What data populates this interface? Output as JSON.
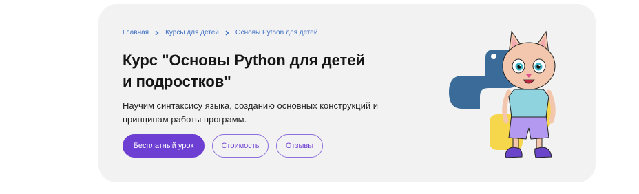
{
  "breadcrumb": {
    "items": [
      "Главная",
      "Курсы для детей",
      "Основы Python для детей"
    ]
  },
  "hero": {
    "title": "Курс \"Основы Python для детей и подростков\"",
    "subtitle": "Научим синтаксису языка, созданию основных конструкций и принципам работы программ."
  },
  "actions": {
    "free_lesson": "Бесплатный урок",
    "price": "Стоимость",
    "reviews": "Отзывы"
  },
  "colors": {
    "accent": "#6d3fd2",
    "link": "#3d6fc4",
    "card_bg": "#f2f2f3",
    "python_blue": "#3b6c99",
    "python_yellow": "#f6d74c"
  },
  "illustration": {
    "icon": "python-cat-mascot-illustration"
  }
}
